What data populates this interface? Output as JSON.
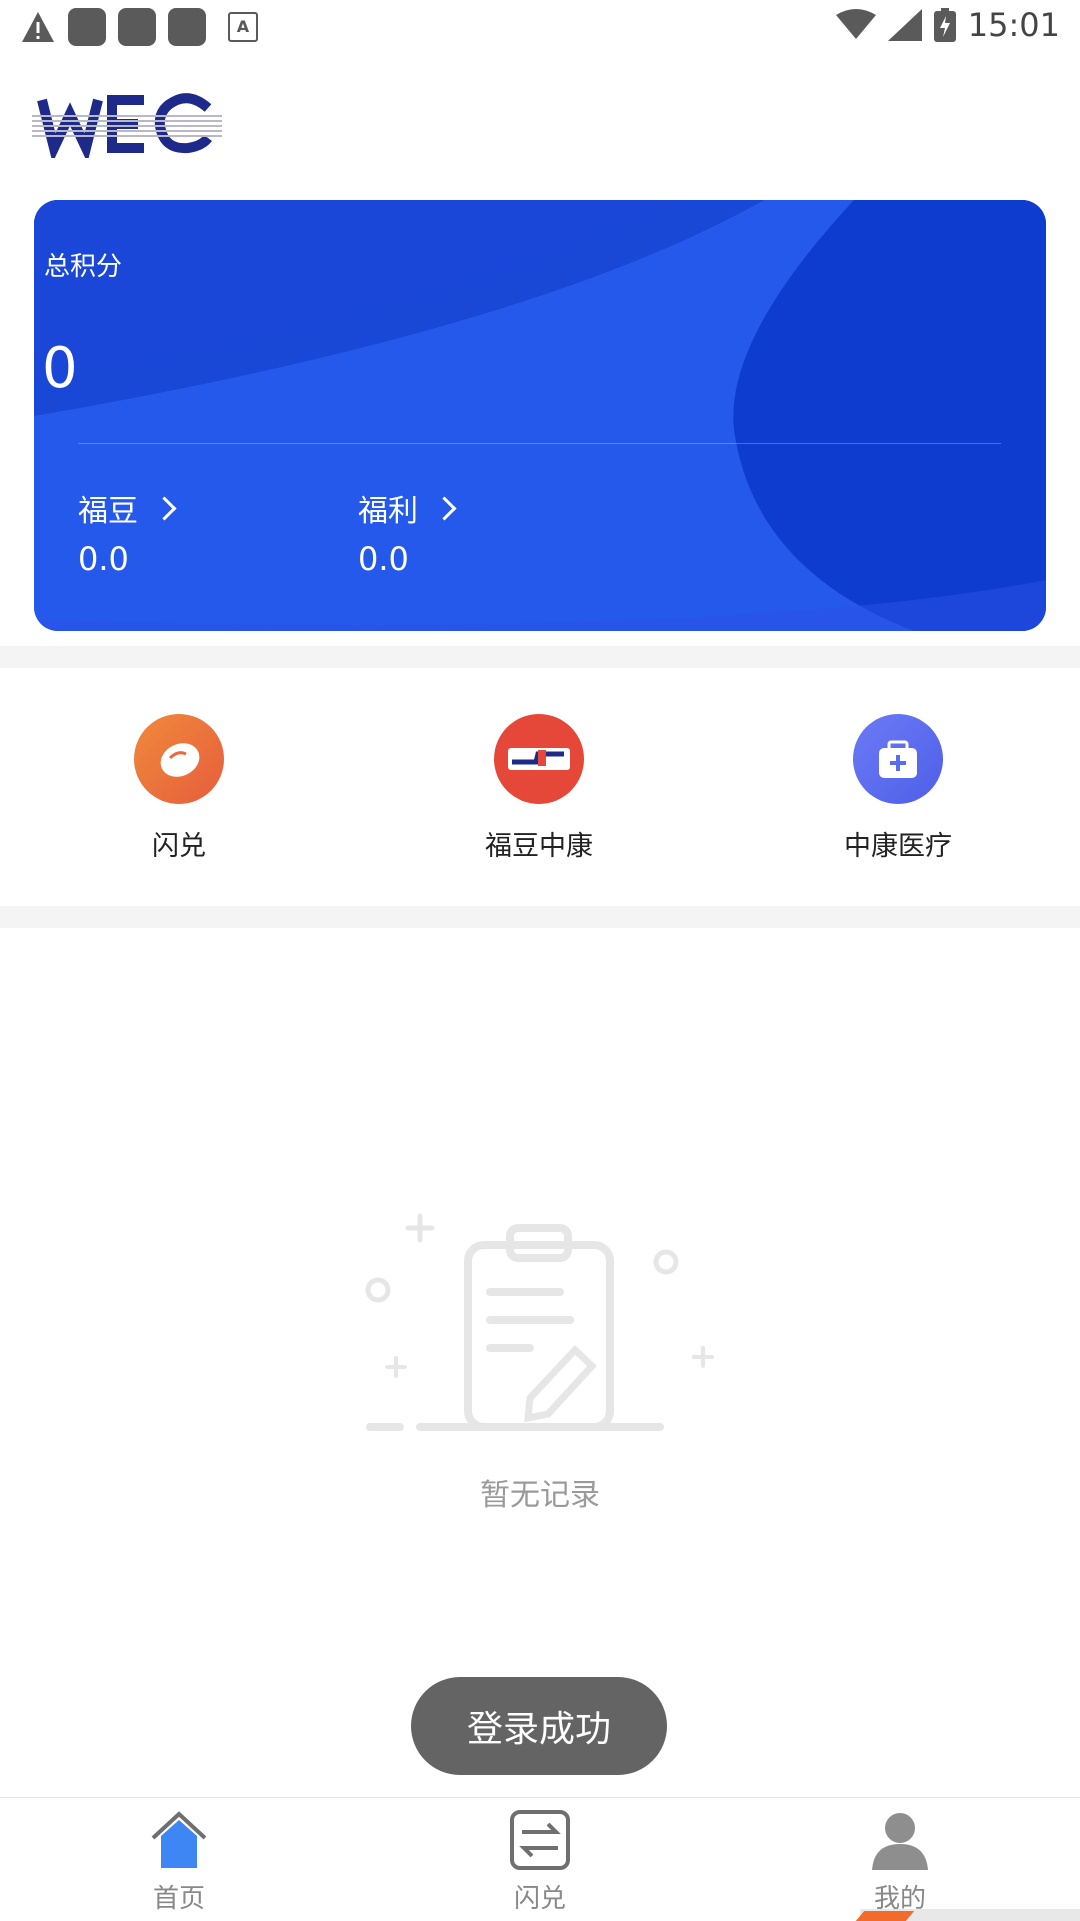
{
  "status_bar": {
    "time": "15:01",
    "icons": [
      "warning-icon",
      "app-icon",
      "app-icon",
      "app-icon",
      "a-icon",
      "wifi-icon",
      "signal-icon",
      "battery-charging-icon"
    ]
  },
  "logo": {
    "text": "WEC"
  },
  "points_card": {
    "title": "总积分",
    "total": "0",
    "stats": [
      {
        "label": "福豆",
        "value": "0.0"
      },
      {
        "label": "福利",
        "value": "0.0"
      }
    ]
  },
  "shortcuts": [
    {
      "label": "闪兑",
      "icon": "bean-icon",
      "color": "#ea6a3c"
    },
    {
      "label": "福豆中康",
      "icon": "zk-logo-icon",
      "color": "#e54838"
    },
    {
      "label": "中康医疗",
      "icon": "medical-kit-icon",
      "color": "#5a6cf0"
    }
  ],
  "empty_state": {
    "text": "暂无记录",
    "icon": "clipboard-icon"
  },
  "toast": {
    "text": "登录成功"
  },
  "tabbar": {
    "items": [
      {
        "label": "首页",
        "icon": "home-icon",
        "active": true
      },
      {
        "label": "闪兑",
        "icon": "exchange-icon",
        "active": false
      },
      {
        "label": "我的",
        "icon": "user-icon",
        "active": false
      }
    ]
  },
  "colors": {
    "accent": "#2056e6",
    "card_dark": "#0d3fd0"
  }
}
